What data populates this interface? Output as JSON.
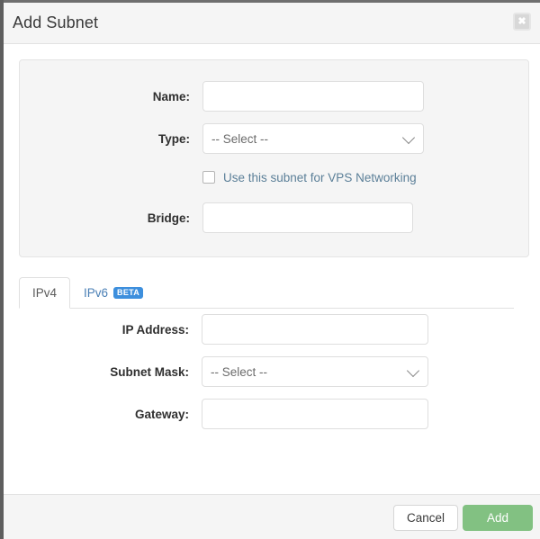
{
  "modal": {
    "title": "Add Subnet",
    "close_icon": "close-icon",
    "close_glyph": "✖"
  },
  "panel": {
    "rows": [
      {
        "label": "Name:",
        "value": "",
        "placeholder": "",
        "control": "text"
      },
      {
        "label": "Type:",
        "value": "-- Select --",
        "control": "select"
      },
      {
        "label": "Bridge:",
        "value": "",
        "placeholder": "",
        "control": "text"
      }
    ],
    "checkbox": {
      "label": "Use this subnet for VPS Networking",
      "checked": false
    }
  },
  "tabs": [
    {
      "label": "IPv4",
      "active": true,
      "badge": ""
    },
    {
      "label": "IPv6",
      "active": false,
      "badge": "BETA"
    }
  ],
  "ipv4_form": {
    "rows": [
      {
        "label": "IP Address:",
        "value": "",
        "placeholder": "",
        "control": "text"
      },
      {
        "label": "Subnet Mask:",
        "value": "-- Select --",
        "control": "select"
      },
      {
        "label": "Gateway:",
        "value": "",
        "placeholder": "",
        "control": "text"
      }
    ]
  },
  "footer": {
    "cancel_label": "Cancel",
    "add_label": "Add"
  },
  "colors": {
    "accent_blue": "#3d8fdd",
    "link_blue": "#4a7fb5",
    "checkbox_label": "#5b7f98",
    "add_green": "#82c182",
    "panel_bg": "#f5f5f5",
    "border": "#e0e0e0"
  }
}
